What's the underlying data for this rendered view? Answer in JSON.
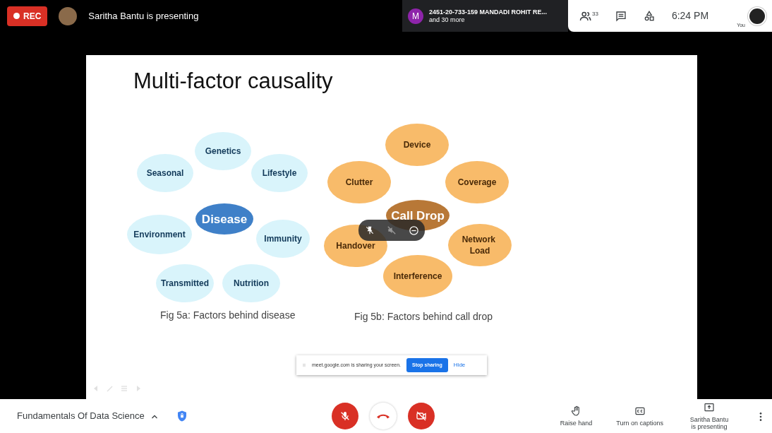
{
  "top_bar": {
    "recording": "REC",
    "presenter": "Saritha Bantu is presenting",
    "participant_chip": {
      "initial": "M",
      "name": "2451-20-733-159 MANDADI ROHIT RE...",
      "more": "and 30 more"
    },
    "participant_count": "33",
    "time": "6:24 PM",
    "self_label": "You"
  },
  "slide": {
    "title": "Multi-factor causality",
    "diagrams": [
      {
        "caption": "Fig 5a: Factors behind disease",
        "nodes": [
          {
            "label": "Genetics",
            "kind": "factor",
            "color": "#d9f4fb"
          },
          {
            "label": "Seasonal",
            "kind": "factor",
            "color": "#d9f4fb"
          },
          {
            "label": "Lifestyle",
            "kind": "factor",
            "color": "#d9f4fb"
          },
          {
            "label": "Disease",
            "kind": "center",
            "color": "#3f80c8"
          },
          {
            "label": "Environment",
            "kind": "factor",
            "color": "#d9f4fb"
          },
          {
            "label": "Immunity",
            "kind": "factor",
            "color": "#d9f4fb"
          },
          {
            "label": "Transmitted",
            "kind": "factor",
            "color": "#d9f4fb"
          },
          {
            "label": "Nutrition",
            "kind": "factor",
            "color": "#d9f4fb"
          }
        ]
      },
      {
        "caption": "Fig 5b: Factors behind call drop",
        "nodes": [
          {
            "label": "Device",
            "kind": "factor",
            "color": "#f8bb6a"
          },
          {
            "label": "Clutter",
            "kind": "factor",
            "color": "#f8bb6a"
          },
          {
            "label": "Coverage",
            "kind": "factor",
            "color": "#f8bb6a"
          },
          {
            "label": "Call Drop",
            "kind": "center",
            "color": "#b87837"
          },
          {
            "label": "Handover",
            "kind": "factor",
            "color": "#f8bb6a"
          },
          {
            "label": "Network Load",
            "kind": "factor",
            "color": "#f8bb6a"
          },
          {
            "label": "Interference",
            "kind": "factor",
            "color": "#f8bb6a"
          }
        ]
      }
    ],
    "share_banner": {
      "message": "meet.google.com is sharing your screen.",
      "stop_button": "Stop sharing",
      "hide_link": "Hide"
    }
  },
  "bottom_bar": {
    "meeting_title": "Fundamentals Of Data Science",
    "mic_on": false,
    "camera_on": false,
    "actions": [
      {
        "kind": "hand",
        "label": "Raise hand"
      },
      {
        "kind": "captions",
        "label": "Turn on captions"
      },
      {
        "kind": "present",
        "label": "Saritha Bantu is presenting"
      }
    ]
  }
}
